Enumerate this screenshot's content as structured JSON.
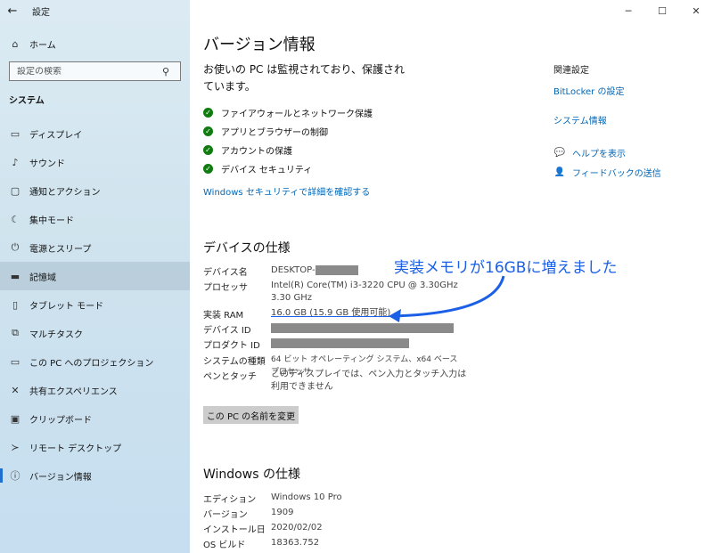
{
  "window": {
    "title": "設定",
    "minimize": "─",
    "maximize": "☐",
    "close": "✕"
  },
  "sidebar": {
    "home": "ホーム",
    "search_placeholder": "設定の検索",
    "section": "システム",
    "items": [
      {
        "label": "ディスプレイ",
        "icon": "display-icon"
      },
      {
        "label": "サウンド",
        "icon": "sound-icon"
      },
      {
        "label": "通知とアクション",
        "icon": "notification-icon"
      },
      {
        "label": "集中モード",
        "icon": "focus-icon"
      },
      {
        "label": "電源とスリープ",
        "icon": "power-icon"
      },
      {
        "label": "記憶域",
        "icon": "storage-icon"
      },
      {
        "label": "タブレット モード",
        "icon": "tablet-icon"
      },
      {
        "label": "マルチタスク",
        "icon": "multitask-icon"
      },
      {
        "label": "この PC へのプロジェクション",
        "icon": "projection-icon"
      },
      {
        "label": "共有エクスペリエンス",
        "icon": "share-icon"
      },
      {
        "label": "クリップボード",
        "icon": "clipboard-icon"
      },
      {
        "label": "リモート デスクトップ",
        "icon": "remote-icon"
      },
      {
        "label": "バージョン情報",
        "icon": "info-icon"
      }
    ]
  },
  "main": {
    "title": "バージョン情報",
    "status": "お使いの PC は監視されており、保護されています。",
    "security_items": [
      "ファイアウォールとネットワーク保護",
      "アプリとブラウザーの制御",
      "アカウントの保護",
      "デバイス セキュリティ"
    ],
    "security_link": "Windows セキュリティで詳細を確認する",
    "device_spec": {
      "heading": "デバイスの仕様",
      "device_name_key": "デバイス名",
      "device_name_val": "DESKTOP-",
      "processor_key": "プロセッサ",
      "processor_val": "Intel(R) Core(TM) i3-3220 CPU @ 3.30GHz   3.30 GHz",
      "ram_key": "実装 RAM",
      "ram_val": "16.0 GB (15.9 GB 使用可能)",
      "device_id_key": "デバイス ID",
      "product_id_key": "プロダクト ID",
      "system_type_key": "システムの種類",
      "system_type_val": "64 ビット オペレーティング システム、x64 ベース プロセッサ",
      "pen_key": "ペンとタッチ",
      "pen_val": "このディスプレイでは、ペン入力とタッチ入力は利用できません"
    },
    "rename_button": "この PC の名前を変更",
    "windows_spec": {
      "heading": "Windows の仕様",
      "edition_key": "エディション",
      "edition_val": "Windows 10 Pro",
      "version_key": "バージョン",
      "version_val": "1909",
      "install_key": "インストール日",
      "install_val": "2020/02/02",
      "build_key": "OS ビルド",
      "build_val": "18363.752"
    }
  },
  "related": {
    "title": "関連設定",
    "bitlocker": "BitLocker の設定",
    "system_info": "システム情報",
    "help": "ヘルプを表示",
    "feedback": "フィードバックの送信"
  },
  "annotation": {
    "text": "実装メモリが16GBに増えました",
    "color": "#1a5fe6"
  },
  "colors": {
    "accent": "#0067b8",
    "check": "#107c10"
  }
}
